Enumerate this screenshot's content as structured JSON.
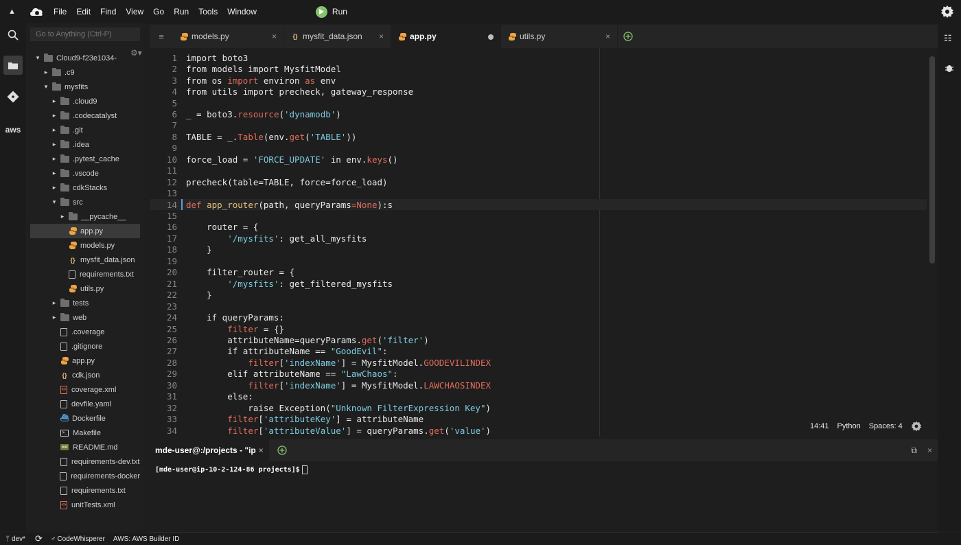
{
  "menubar": {
    "items": [
      "File",
      "Edit",
      "Find",
      "View",
      "Go",
      "Run",
      "Tools",
      "Window"
    ],
    "run_label": "Run"
  },
  "tree": {
    "goto_placeholder": "Go to Anything (Ctrl-P)",
    "rows": [
      {
        "label": "Cloud9-f23e1034-",
        "kind": "folder",
        "expanded": true,
        "depth": 0
      },
      {
        "label": ".c9",
        "kind": "folder",
        "expanded": false,
        "depth": 1
      },
      {
        "label": "mysfits",
        "kind": "folder",
        "expanded": true,
        "depth": 1
      },
      {
        "label": ".cloud9",
        "kind": "folder",
        "expanded": false,
        "depth": 2
      },
      {
        "label": ".codecatalyst",
        "kind": "folder",
        "expanded": false,
        "depth": 2
      },
      {
        "label": ".git",
        "kind": "folder",
        "expanded": false,
        "depth": 2
      },
      {
        "label": ".idea",
        "kind": "folder",
        "expanded": false,
        "depth": 2
      },
      {
        "label": ".pytest_cache",
        "kind": "folder",
        "expanded": false,
        "depth": 2
      },
      {
        "label": ".vscode",
        "kind": "folder",
        "expanded": false,
        "depth": 2
      },
      {
        "label": "cdkStacks",
        "kind": "folder",
        "expanded": false,
        "depth": 2
      },
      {
        "label": "src",
        "kind": "folder",
        "expanded": true,
        "depth": 2
      },
      {
        "label": "__pycache__",
        "kind": "folder",
        "expanded": false,
        "depth": 3
      },
      {
        "label": "app.py",
        "kind": "py",
        "depth": 3,
        "selected": true
      },
      {
        "label": "models.py",
        "kind": "py",
        "depth": 3
      },
      {
        "label": "mysfit_data.json",
        "kind": "json",
        "depth": 3
      },
      {
        "label": "requirements.txt",
        "kind": "doc",
        "depth": 3
      },
      {
        "label": "utils.py",
        "kind": "py",
        "depth": 3
      },
      {
        "label": "tests",
        "kind": "folder",
        "expanded": false,
        "depth": 2
      },
      {
        "label": "web",
        "kind": "folder",
        "expanded": false,
        "depth": 2
      },
      {
        "label": ".coverage",
        "kind": "doc",
        "depth": 2
      },
      {
        "label": ".gitignore",
        "kind": "doc",
        "depth": 2
      },
      {
        "label": "app.py",
        "kind": "py",
        "depth": 2
      },
      {
        "label": "cdk.json",
        "kind": "json",
        "depth": 2
      },
      {
        "label": "coverage.xml",
        "kind": "xml",
        "depth": 2
      },
      {
        "label": "devfile.yaml",
        "kind": "doc",
        "depth": 2
      },
      {
        "label": "Dockerfile",
        "kind": "docker",
        "depth": 2
      },
      {
        "label": "Makefile",
        "kind": "make",
        "depth": 2
      },
      {
        "label": "README.md",
        "kind": "md",
        "depth": 2
      },
      {
        "label": "requirements-dev.txt",
        "kind": "doc",
        "depth": 2
      },
      {
        "label": "requirements-docker",
        "kind": "doc",
        "depth": 2
      },
      {
        "label": "requirements.txt",
        "kind": "doc",
        "depth": 2
      },
      {
        "label": "unitTests.xml",
        "kind": "xml",
        "depth": 2
      }
    ]
  },
  "tabs": [
    {
      "label": "models.py",
      "kind": "py",
      "active": false,
      "modified": false
    },
    {
      "label": "mysfit_data.json",
      "kind": "json",
      "active": false,
      "modified": false
    },
    {
      "label": "app.py",
      "kind": "py",
      "active": true,
      "modified": true
    },
    {
      "label": "utils.py",
      "kind": "py",
      "active": false,
      "modified": false
    }
  ],
  "code": [
    [
      [
        "",
        "import boto3"
      ]
    ],
    [
      [
        "",
        "from models import MysfitModel"
      ]
    ],
    [
      [
        "",
        "from os "
      ],
      [
        "kw",
        "import"
      ],
      [
        "",
        " environ "
      ],
      [
        "kw",
        "as"
      ],
      [
        "",
        " env"
      ]
    ],
    [
      [
        "",
        "from utils import precheck, gateway_response"
      ]
    ],
    [],
    [
      [
        "",
        "_ = boto3."
      ],
      [
        "kw",
        "resource"
      ],
      [
        "",
        "("
      ],
      [
        "str",
        "'dynamodb'"
      ],
      [
        "",
        ")"
      ]
    ],
    [],
    [
      [
        "",
        "TABLE = _."
      ],
      [
        "kw",
        "Table"
      ],
      [
        "",
        "(env."
      ],
      [
        "kw",
        "get"
      ],
      [
        "",
        "("
      ],
      [
        "str",
        "'TABLE'"
      ],
      [
        "",
        "))"
      ]
    ],
    [],
    [
      [
        "",
        "force_load = "
      ],
      [
        "str",
        "'FORCE_UPDATE'"
      ],
      [
        "",
        " in env."
      ],
      [
        "kw",
        "keys"
      ],
      [
        "",
        "()"
      ]
    ],
    [],
    [
      [
        "",
        "precheck(table=TABLE, force=force_load)"
      ]
    ],
    [],
    [
      [
        "kw",
        "def"
      ],
      [
        "",
        " "
      ],
      [
        "fn",
        "app_router"
      ],
      [
        "",
        "(path, queryParams"
      ],
      [
        "kw",
        "=None"
      ],
      [
        "",
        "):s"
      ]
    ],
    [],
    [
      [
        "",
        "    router = {"
      ]
    ],
    [
      [
        "",
        "        "
      ],
      [
        "str",
        "'/mysfits'"
      ],
      [
        "",
        ": get_all_mysfits"
      ]
    ],
    [
      [
        "",
        "    }"
      ]
    ],
    [],
    [
      [
        "",
        "    filter_router = {"
      ]
    ],
    [
      [
        "",
        "        "
      ],
      [
        "str",
        "'/mysfits'"
      ],
      [
        "",
        ": get_filtered_mysfits"
      ]
    ],
    [
      [
        "",
        "    }"
      ]
    ],
    [],
    [
      [
        "",
        "    if queryParams:"
      ]
    ],
    [
      [
        "",
        "        "
      ],
      [
        "kw",
        "filter"
      ],
      [
        "",
        " = {}"
      ]
    ],
    [
      [
        "",
        "        attributeName=queryParams."
      ],
      [
        "kw",
        "get"
      ],
      [
        "",
        "("
      ],
      [
        "str",
        "'filter'"
      ],
      [
        "",
        ")"
      ]
    ],
    [
      [
        "",
        "        if attributeName == "
      ],
      [
        "str",
        "\"GoodEvil\""
      ],
      [
        "",
        ":"
      ]
    ],
    [
      [
        "",
        "            "
      ],
      [
        "kw",
        "filter"
      ],
      [
        "",
        "["
      ],
      [
        "str",
        "'indexName'"
      ],
      [
        "",
        "] = MysfitModel."
      ],
      [
        "kw",
        "GOODEVILINDEX"
      ]
    ],
    [
      [
        "",
        "        elif attributeName == "
      ],
      [
        "str",
        "\"LawChaos\""
      ],
      [
        "",
        ":"
      ]
    ],
    [
      [
        "",
        "            "
      ],
      [
        "kw",
        "filter"
      ],
      [
        "",
        "["
      ],
      [
        "str",
        "'indexName'"
      ],
      [
        "",
        "] = MysfitModel."
      ],
      [
        "kw",
        "LAWCHAOSINDEX"
      ]
    ],
    [
      [
        "",
        "        else:"
      ]
    ],
    [
      [
        "",
        "            raise Exception("
      ],
      [
        "str",
        "\"Unknown FilterExpression Key\""
      ],
      [
        "",
        ")"
      ]
    ],
    [
      [
        "",
        "        "
      ],
      [
        "kw",
        "filter"
      ],
      [
        "",
        "["
      ],
      [
        "str",
        "'attributeKey'"
      ],
      [
        "",
        "] = attributeName"
      ]
    ],
    [
      [
        "",
        "        "
      ],
      [
        "kw",
        "filter"
      ],
      [
        "",
        "["
      ],
      [
        "str",
        "'attributeValue'"
      ],
      [
        "",
        "] = queryParams."
      ],
      [
        "kw",
        "get"
      ],
      [
        "",
        "("
      ],
      [
        "str",
        "'value'"
      ],
      [
        "",
        ")"
      ]
    ]
  ],
  "current_line": 14,
  "status": {
    "position": "14:41",
    "language": "Python",
    "indent": "Spaces: 4"
  },
  "terminal": {
    "tab_label": "mde-user@:/projects - \"ip",
    "prompt": "[mde-user@ip-10-2-124-86 projects]$"
  },
  "bottombar": {
    "branch": "dev*",
    "codewhisperer": "CodeWhisperer",
    "aws": "AWS: AWS Builder ID"
  },
  "colors": {
    "accent_green": "#85c46c",
    "keyword": "#e06c5a",
    "string": "#7ecbe0",
    "function": "#e5c07b",
    "python_icon": "#f0a540"
  }
}
